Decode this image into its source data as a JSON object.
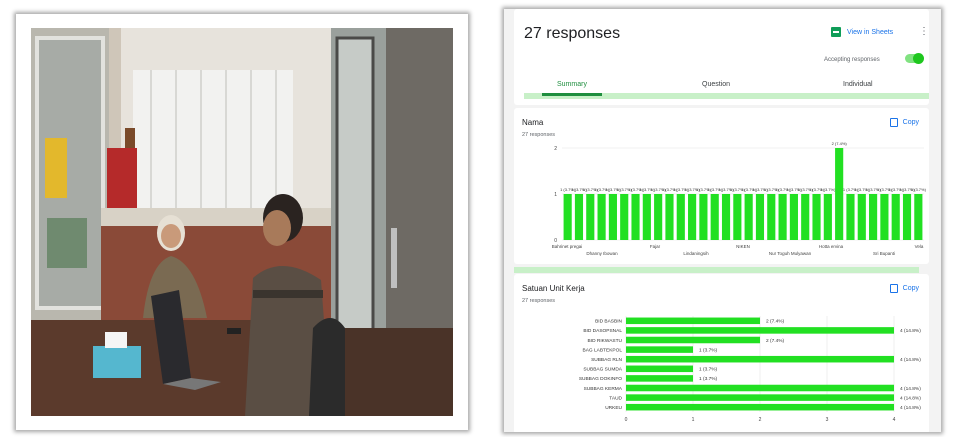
{
  "header": {
    "title": "27 responses",
    "view_sheets": "View in Sheets",
    "accepting": "Accepting responses",
    "accepting_on": true
  },
  "tabs": [
    {
      "label": "Summary",
      "active": true
    },
    {
      "label": "Question",
      "active": false
    },
    {
      "label": "Individual",
      "active": false
    }
  ],
  "colors": {
    "bar": "#22e022",
    "accent": "#1e8e3e",
    "link": "#1a73e8"
  },
  "icons": [
    "sheets-icon",
    "more-vert-icon",
    "copy-icon"
  ],
  "nama": {
    "title": "Nama",
    "responses": "27 responses",
    "copy": "Copy"
  },
  "unit": {
    "title": "Satuan Unit Kerja",
    "responses": "27 responses",
    "copy": "Copy"
  },
  "chart_data": [
    {
      "type": "bar",
      "title": "Nama",
      "values": [
        1,
        1,
        1,
        1,
        1,
        1,
        1,
        1,
        1,
        1,
        1,
        1,
        1,
        1,
        1,
        1,
        1,
        1,
        1,
        1,
        1,
        1,
        1,
        1,
        2,
        1,
        1,
        1,
        1,
        1,
        1,
        1
      ],
      "data_labels": [
        "1 (3.7%)",
        "2 (7.4%)"
      ],
      "tick_labels_row1": [
        "Bahrinet pregai",
        "Fajar",
        "NIKEN",
        "Hotta ervina",
        "Vela"
      ],
      "tick_labels_row2": [
        "Dhanny Ibowan",
        "Lindaningsih",
        "Nur Toguh Mulyawan",
        "Sri Bupanti"
      ],
      "ylim": [
        0,
        2
      ],
      "yticks": [
        0,
        1,
        2
      ],
      "grid": true
    },
    {
      "type": "bar",
      "orientation": "horizontal",
      "title": "Satuan Unit Kerja",
      "categories": [
        "BID BASBIN",
        "BID DASOPSNAL",
        "BID RIKWASTU",
        "BAG LABTEKPOL",
        "SUBBAG RLN",
        "SUBBAG SUMDA",
        "SUBBAG DOKINFO",
        "SUBBAG KERMA",
        "TAUD",
        "URKEU"
      ],
      "values": [
        2,
        4,
        2,
        1,
        4,
        1,
        1,
        4,
        4,
        4
      ],
      "labels": [
        "2 (7.4%)",
        "4 (14.8%)",
        "2 (7.4%)",
        "1 (3.7%)",
        "4 (14.8%)",
        "1 (3.7%)",
        "1 (3.7%)",
        "4 (14.8%)",
        "4 (14.8%)",
        "4 (14.8%)"
      ],
      "xlim": [
        0,
        4
      ],
      "xticks": [
        0,
        1,
        2,
        3,
        4
      ],
      "grid": true
    }
  ]
}
